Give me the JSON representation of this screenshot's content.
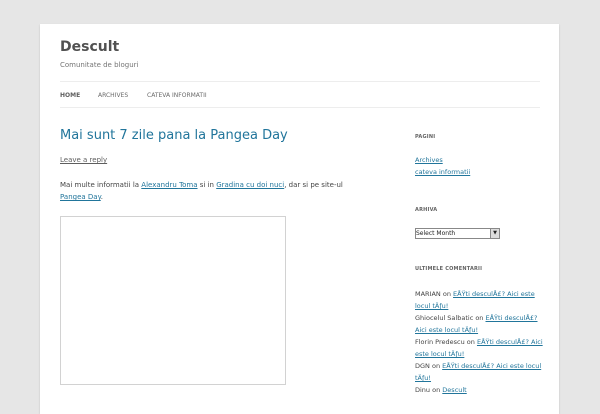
{
  "site": {
    "title": "Descult",
    "description": "Comunitate de bloguri"
  },
  "nav": {
    "items": [
      {
        "label": "HOME"
      },
      {
        "label": "ARCHIVES"
      },
      {
        "label": "CATEVA INFORMATII"
      }
    ]
  },
  "post": {
    "title": "Mai sunt 7 zile pana la Pangea Day",
    "leave_reply": "Leave a reply",
    "content": {
      "text1": "Mai multe informatii la ",
      "link1": "Alexandru Toma",
      "text2": " si in ",
      "link2": "Gradina cu doi nuci",
      "text3": ", dar si pe site-ul ",
      "link3": "Pangea Day",
      "text4": "."
    }
  },
  "sidebar": {
    "pages_title": "PAGINI",
    "pages": [
      {
        "label": "Archives"
      },
      {
        "label": "cateva informatii"
      }
    ],
    "archive_title": "ARHIVA",
    "archive_select": "Select Month",
    "comments_title": "ULTIMELE COMENTARII",
    "comments": [
      {
        "author": "MARIAN",
        "on": " on ",
        "link": "EÅŸti desculÅ£? Aici este locul tÄƒu!"
      },
      {
        "author": "Ghiocelul Salbatic",
        "on": " on ",
        "link": "EÅŸti desculÅ£? Aici este locul tÄƒu!"
      },
      {
        "author": "Florin Predescu",
        "on": " on ",
        "link": "EÅŸti desculÅ£? Aici este locul tÄƒu!"
      },
      {
        "author": "DGN",
        "on": " on ",
        "link": "EÅŸti desculÅ£? Aici este locul tÄƒu!"
      },
      {
        "author": "Dinu",
        "on": " on ",
        "link": "Descult"
      }
    ]
  }
}
